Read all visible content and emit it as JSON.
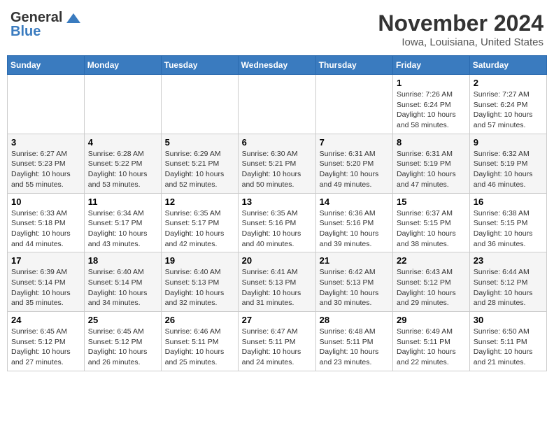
{
  "header": {
    "logo_line1": "General",
    "logo_line2": "Blue",
    "month_title": "November 2024",
    "location": "Iowa, Louisiana, United States"
  },
  "weekdays": [
    "Sunday",
    "Monday",
    "Tuesday",
    "Wednesday",
    "Thursday",
    "Friday",
    "Saturday"
  ],
  "weeks": [
    [
      {
        "day": "",
        "info": ""
      },
      {
        "day": "",
        "info": ""
      },
      {
        "day": "",
        "info": ""
      },
      {
        "day": "",
        "info": ""
      },
      {
        "day": "",
        "info": ""
      },
      {
        "day": "1",
        "info": "Sunrise: 7:26 AM\nSunset: 6:24 PM\nDaylight: 10 hours and 58 minutes."
      },
      {
        "day": "2",
        "info": "Sunrise: 7:27 AM\nSunset: 6:24 PM\nDaylight: 10 hours and 57 minutes."
      }
    ],
    [
      {
        "day": "3",
        "info": "Sunrise: 6:27 AM\nSunset: 5:23 PM\nDaylight: 10 hours and 55 minutes."
      },
      {
        "day": "4",
        "info": "Sunrise: 6:28 AM\nSunset: 5:22 PM\nDaylight: 10 hours and 53 minutes."
      },
      {
        "day": "5",
        "info": "Sunrise: 6:29 AM\nSunset: 5:21 PM\nDaylight: 10 hours and 52 minutes."
      },
      {
        "day": "6",
        "info": "Sunrise: 6:30 AM\nSunset: 5:21 PM\nDaylight: 10 hours and 50 minutes."
      },
      {
        "day": "7",
        "info": "Sunrise: 6:31 AM\nSunset: 5:20 PM\nDaylight: 10 hours and 49 minutes."
      },
      {
        "day": "8",
        "info": "Sunrise: 6:31 AM\nSunset: 5:19 PM\nDaylight: 10 hours and 47 minutes."
      },
      {
        "day": "9",
        "info": "Sunrise: 6:32 AM\nSunset: 5:19 PM\nDaylight: 10 hours and 46 minutes."
      }
    ],
    [
      {
        "day": "10",
        "info": "Sunrise: 6:33 AM\nSunset: 5:18 PM\nDaylight: 10 hours and 44 minutes."
      },
      {
        "day": "11",
        "info": "Sunrise: 6:34 AM\nSunset: 5:17 PM\nDaylight: 10 hours and 43 minutes."
      },
      {
        "day": "12",
        "info": "Sunrise: 6:35 AM\nSunset: 5:17 PM\nDaylight: 10 hours and 42 minutes."
      },
      {
        "day": "13",
        "info": "Sunrise: 6:35 AM\nSunset: 5:16 PM\nDaylight: 10 hours and 40 minutes."
      },
      {
        "day": "14",
        "info": "Sunrise: 6:36 AM\nSunset: 5:16 PM\nDaylight: 10 hours and 39 minutes."
      },
      {
        "day": "15",
        "info": "Sunrise: 6:37 AM\nSunset: 5:15 PM\nDaylight: 10 hours and 38 minutes."
      },
      {
        "day": "16",
        "info": "Sunrise: 6:38 AM\nSunset: 5:15 PM\nDaylight: 10 hours and 36 minutes."
      }
    ],
    [
      {
        "day": "17",
        "info": "Sunrise: 6:39 AM\nSunset: 5:14 PM\nDaylight: 10 hours and 35 minutes."
      },
      {
        "day": "18",
        "info": "Sunrise: 6:40 AM\nSunset: 5:14 PM\nDaylight: 10 hours and 34 minutes."
      },
      {
        "day": "19",
        "info": "Sunrise: 6:40 AM\nSunset: 5:13 PM\nDaylight: 10 hours and 32 minutes."
      },
      {
        "day": "20",
        "info": "Sunrise: 6:41 AM\nSunset: 5:13 PM\nDaylight: 10 hours and 31 minutes."
      },
      {
        "day": "21",
        "info": "Sunrise: 6:42 AM\nSunset: 5:13 PM\nDaylight: 10 hours and 30 minutes."
      },
      {
        "day": "22",
        "info": "Sunrise: 6:43 AM\nSunset: 5:12 PM\nDaylight: 10 hours and 29 minutes."
      },
      {
        "day": "23",
        "info": "Sunrise: 6:44 AM\nSunset: 5:12 PM\nDaylight: 10 hours and 28 minutes."
      }
    ],
    [
      {
        "day": "24",
        "info": "Sunrise: 6:45 AM\nSunset: 5:12 PM\nDaylight: 10 hours and 27 minutes."
      },
      {
        "day": "25",
        "info": "Sunrise: 6:45 AM\nSunset: 5:12 PM\nDaylight: 10 hours and 26 minutes."
      },
      {
        "day": "26",
        "info": "Sunrise: 6:46 AM\nSunset: 5:11 PM\nDaylight: 10 hours and 25 minutes."
      },
      {
        "day": "27",
        "info": "Sunrise: 6:47 AM\nSunset: 5:11 PM\nDaylight: 10 hours and 24 minutes."
      },
      {
        "day": "28",
        "info": "Sunrise: 6:48 AM\nSunset: 5:11 PM\nDaylight: 10 hours and 23 minutes."
      },
      {
        "day": "29",
        "info": "Sunrise: 6:49 AM\nSunset: 5:11 PM\nDaylight: 10 hours and 22 minutes."
      },
      {
        "day": "30",
        "info": "Sunrise: 6:50 AM\nSunset: 5:11 PM\nDaylight: 10 hours and 21 minutes."
      }
    ]
  ]
}
